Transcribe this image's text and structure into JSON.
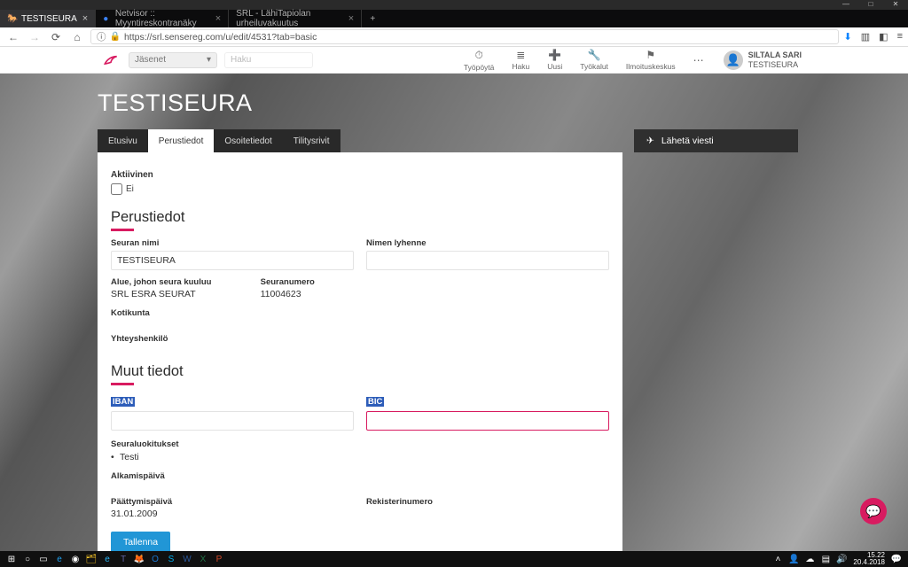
{
  "browser": {
    "tabs": [
      {
        "label": "TESTISEURA",
        "active": true
      },
      {
        "label": "Netvisor :: Myyntireskontranäky",
        "active": false
      },
      {
        "label": "SRL - LähiTapiolan urheiluvakuutus",
        "active": false
      }
    ],
    "url": "https://srl.sensereg.com/u/edit/4531?tab=basic"
  },
  "header": {
    "members_dd": "Jäsenet",
    "search_placeholder": "Haku",
    "items": [
      {
        "icon": "⏱",
        "label": "Työpöytä"
      },
      {
        "icon": "≣",
        "label": "Haku"
      },
      {
        "icon": "➕",
        "label": "Uusi"
      },
      {
        "icon": "🔧",
        "label": "Työkalut"
      },
      {
        "icon": "⚑",
        "label": "Ilmoituskeskus"
      }
    ],
    "user_name": "SILTALA SARI",
    "user_org": "TESTISEURA"
  },
  "page": {
    "title": "TESTISEURA",
    "tabs": [
      "Etusivu",
      "Perustiedot",
      "Osoitetiedot",
      "Tilitysrivit"
    ],
    "active_tab": "Perustiedot",
    "send_label": "Lähetä viesti"
  },
  "form": {
    "active_label": "Aktiivinen",
    "active_value": "Ei",
    "section_basic": "Perustiedot",
    "club_name_label": "Seuran nimi",
    "club_name_value": "TESTISEURA",
    "abbr_label": "Nimen lyhenne",
    "abbr_value": "",
    "region_label": "Alue, johon seura kuuluu",
    "region_value": "SRL ESRA SEURAT",
    "clubno_label": "Seuranumero",
    "clubno_value": "11004623",
    "municipality_label": "Kotikunta",
    "contact_label": "Yhteyshenkilö",
    "section_other": "Muut tiedot",
    "iban_label": "IBAN",
    "iban_value": "",
    "bic_label": "BIC",
    "bic_value": "",
    "classifications_label": "Seuraluokitukset",
    "classifications_item": "Testi",
    "start_date_label": "Alkamispäivä",
    "end_date_label": "Päättymispäivä",
    "end_date_value": "31.01.2009",
    "regno_label": "Rekisterinumero",
    "save_label": "Tallenna"
  },
  "taskbar": {
    "time": "15.22",
    "date": "20.4.2018"
  }
}
